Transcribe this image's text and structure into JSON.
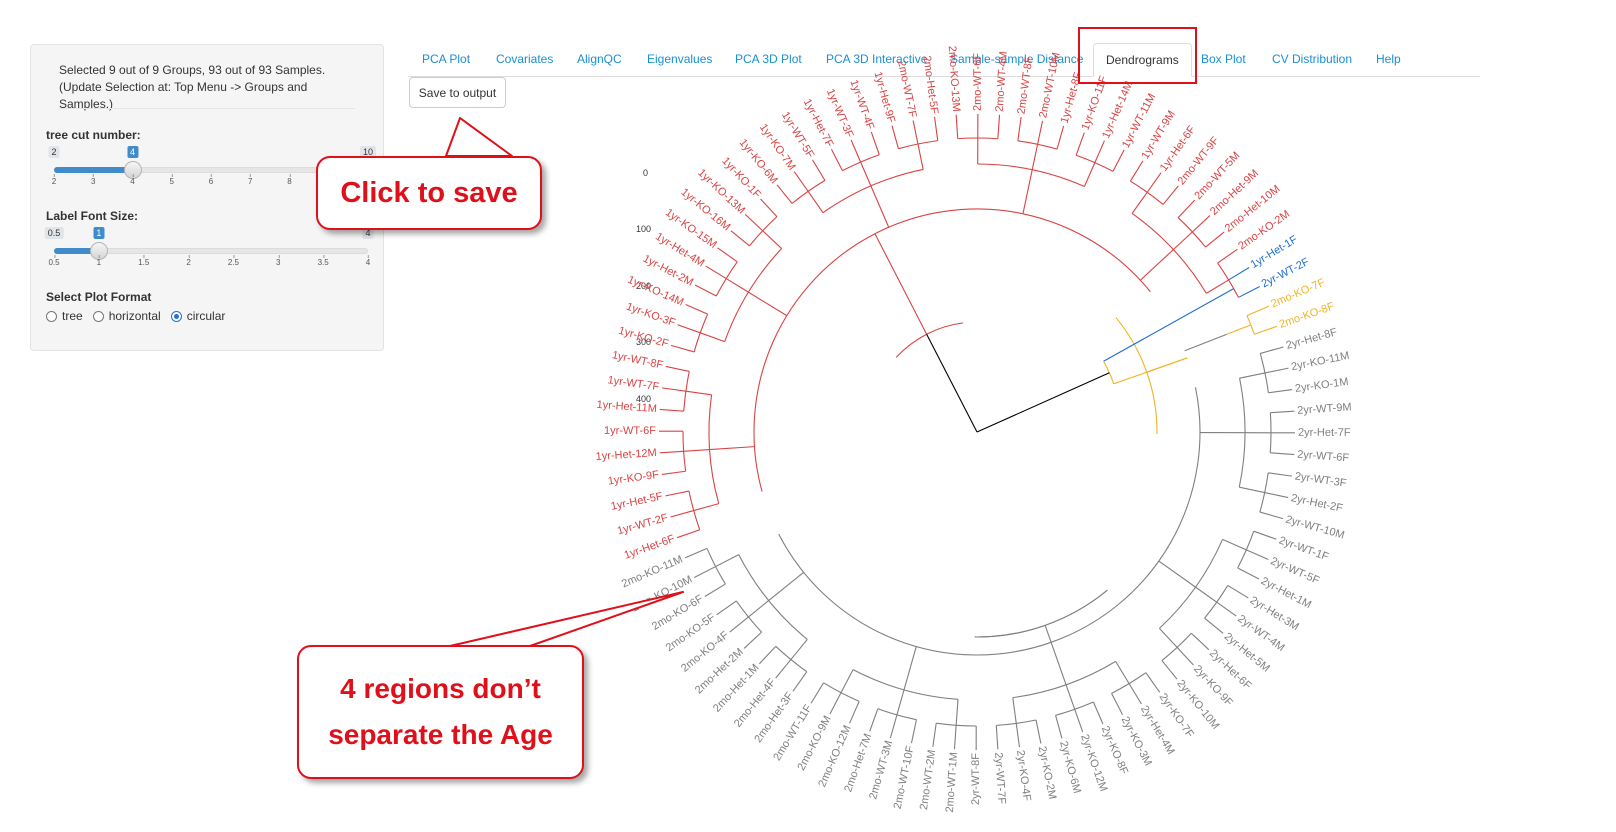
{
  "sidebar": {
    "selection_text": "Selected 9 out of 9 Groups, 93 out of 93 Samples. (Update Selection at: Top Menu -> Groups and Samples.)",
    "tree_cut": {
      "label": "tree cut number:",
      "min": 2,
      "max": 10,
      "value": 4,
      "ticks": [
        "2",
        "3",
        "4",
        "5",
        "6",
        "7",
        "8",
        "9",
        "10"
      ]
    },
    "font_size": {
      "label": "Label Font Size:",
      "min": 0.5,
      "max": 4,
      "value": 1,
      "ticks": [
        "0.5",
        "1",
        "1.5",
        "2",
        "2.5",
        "3",
        "3.5",
        "4"
      ]
    },
    "plot_format": {
      "label": "Select Plot Format",
      "options": [
        "tree",
        "horizontal",
        "circular"
      ],
      "selected": "circular"
    }
  },
  "tabs": [
    "PCA Plot",
    "Covariates",
    "AlignQC",
    "Eigenvalues",
    "PCA 3D Plot",
    "PCA 3D Interactive",
    "Sample-sample Distance",
    "Dendrograms",
    "Box Plot",
    "CV Distribution",
    "Help"
  ],
  "active_tab": "Dendrograms",
  "save_button": "Save to output",
  "y_axis_labels": [
    "0",
    "100",
    "200",
    "300",
    "400"
  ],
  "dendrogram": {
    "cluster_colors": {
      "red": "#d94343",
      "blue": "#1f6fd0",
      "yellow": "#f0b323",
      "gray": "#7f7f7f",
      "root": "#000000"
    },
    "leaves": [
      "2yr-Het-8F",
      "2yr-KO-11M",
      "2yr-KO-1M",
      "2yr-WT-9M",
      "2yr-Het-7F",
      "2yr-WT-6F",
      "2yr-WT-3F",
      "2yr-Het-2F",
      "2yr-WT-10M",
      "2yr-WT-1F",
      "2yr-WT-5F",
      "2yr-Het-1M",
      "2yr-Het-3M",
      "2yr-WT-4M",
      "2yr-Het-5M",
      "2yr-Het-6F",
      "2yr-KO-9F",
      "2yr-KO-10M",
      "2yr-KO-7F",
      "2yr-Het-4M",
      "2yr-KO-3M",
      "2yr-KO-8F",
      "2yr-KO-12M",
      "2yr-KO-6M",
      "2yr-KO-2M",
      "2yr-KO-4F",
      "2yr-WT-7F",
      "2yr-WT-8F",
      "2mo-WT-1M",
      "2mo-WT-2M",
      "2mo-WT-10F",
      "2mo-WT-3M",
      "2mo-Het-7M",
      "2mo-KO-12M",
      "2mo-KO-9M",
      "2mo-WT-11F",
      "2mo-Het-3F",
      "2mo-Het-4F",
      "2mo-Het-1M",
      "2mo-Het-2M",
      "2mo-KO-4F",
      "2mo-KO-5F",
      "2mo-KO-6F",
      "2mo-KO-10M",
      "2mo-KO-11M",
      "1yr-Het-6F",
      "1yr-WT-2F",
      "1yr-Het-5F",
      "1yr-KO-9F",
      "1yr-Het-12M",
      "1yr-WT-6F",
      "1yr-Het-11M",
      "1yr-WT-7F",
      "1yr-WT-8F",
      "1yr-KO-2F",
      "1yr-KO-3F",
      "1yr-KO-14M",
      "1yr-Het-2M",
      "1yr-Het-4M",
      "1yr-KO-15M",
      "1yr-KO-16M",
      "1yr-KO-13M",
      "1yr-KO-1F",
      "1yr-KO-6M",
      "1yr-KO-7M",
      "1yr-WT-5F",
      "1yr-Het-7F",
      "1yr-WT-3F",
      "1yr-WT-4F",
      "1yr-Het-9F",
      "2mo-WT-7F",
      "2mo-Het-5F",
      "2mo-KO-13M",
      "2mo-WT-6F",
      "2mo-WT-4M",
      "2mo-WT-8F",
      "2mo-WT-10M",
      "1yr-Het-8F",
      "1yr-KO-11F",
      "1yr-Het-14M",
      "1yr-WT-11M",
      "1yr-WT-9M",
      "1yr-Het-6F",
      "2mo-WT-9F",
      "2mo-WT-5M",
      "2mo-Het-9M",
      "2mo-Het-10M",
      "2mo-KO-2M",
      "1yr-Het-1F",
      "2yr-WT-2F",
      "2mo-KO-7F",
      "2mo-KO-8F"
    ]
  },
  "annotations": {
    "save_note": "Click to save",
    "region_note": "4 regions don’t separate the Age"
  }
}
